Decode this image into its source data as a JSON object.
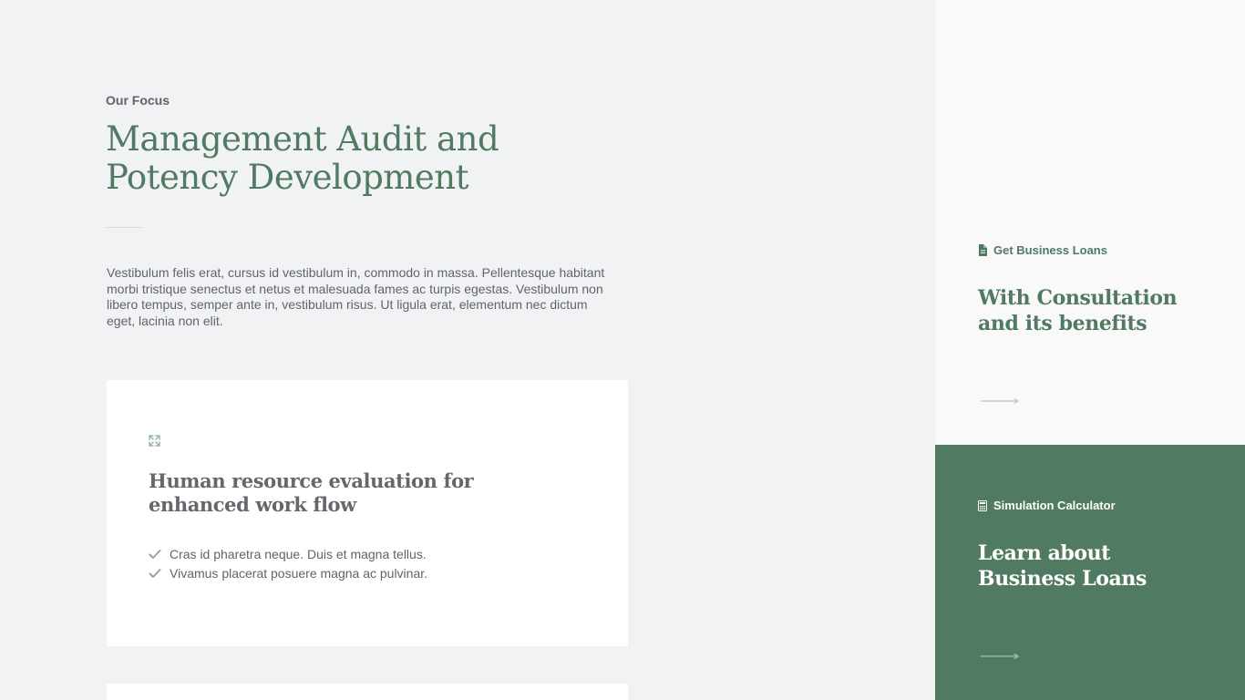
{
  "focus_section": {
    "eyebrow": "Our Focus",
    "title": "Management Audit and Potency Development",
    "description": "Vestibulum felis erat, cursus id vestibulum in, commodo in massa. Pellentesque habitant morbi tristique senectus et netus et malesuada fames ac turpis egestas. Vestibulum non libero tempus, semper ante in, vestibulum risus. Ut ligula erat, elementum nec dictum eget, lacinia non elit."
  },
  "feature_card": {
    "icon": "expand-icon",
    "title": "Human resource evaluation for enhanced work flow",
    "items": [
      "Cras id pharetra neque. Duis et magna tellus.",
      "Vivamus placerat posuere magna ac pulvinar."
    ]
  },
  "side_panels": [
    {
      "icon": "document-icon",
      "label": "Get Business Loans",
      "title": "With Consultation and its benefits",
      "action_icon": "arrow-right-icon"
    },
    {
      "icon": "calculator-icon",
      "label": "Simulation Calculator",
      "title": "Learn about Business Loans",
      "action_icon": "arrow-right-icon"
    }
  ],
  "colors": {
    "brand_green": "#507a61",
    "page_background": "#f1f2f4",
    "light_panel": "#f9f9fa",
    "card_background": "#ffffff",
    "body_text": "#60646a"
  }
}
